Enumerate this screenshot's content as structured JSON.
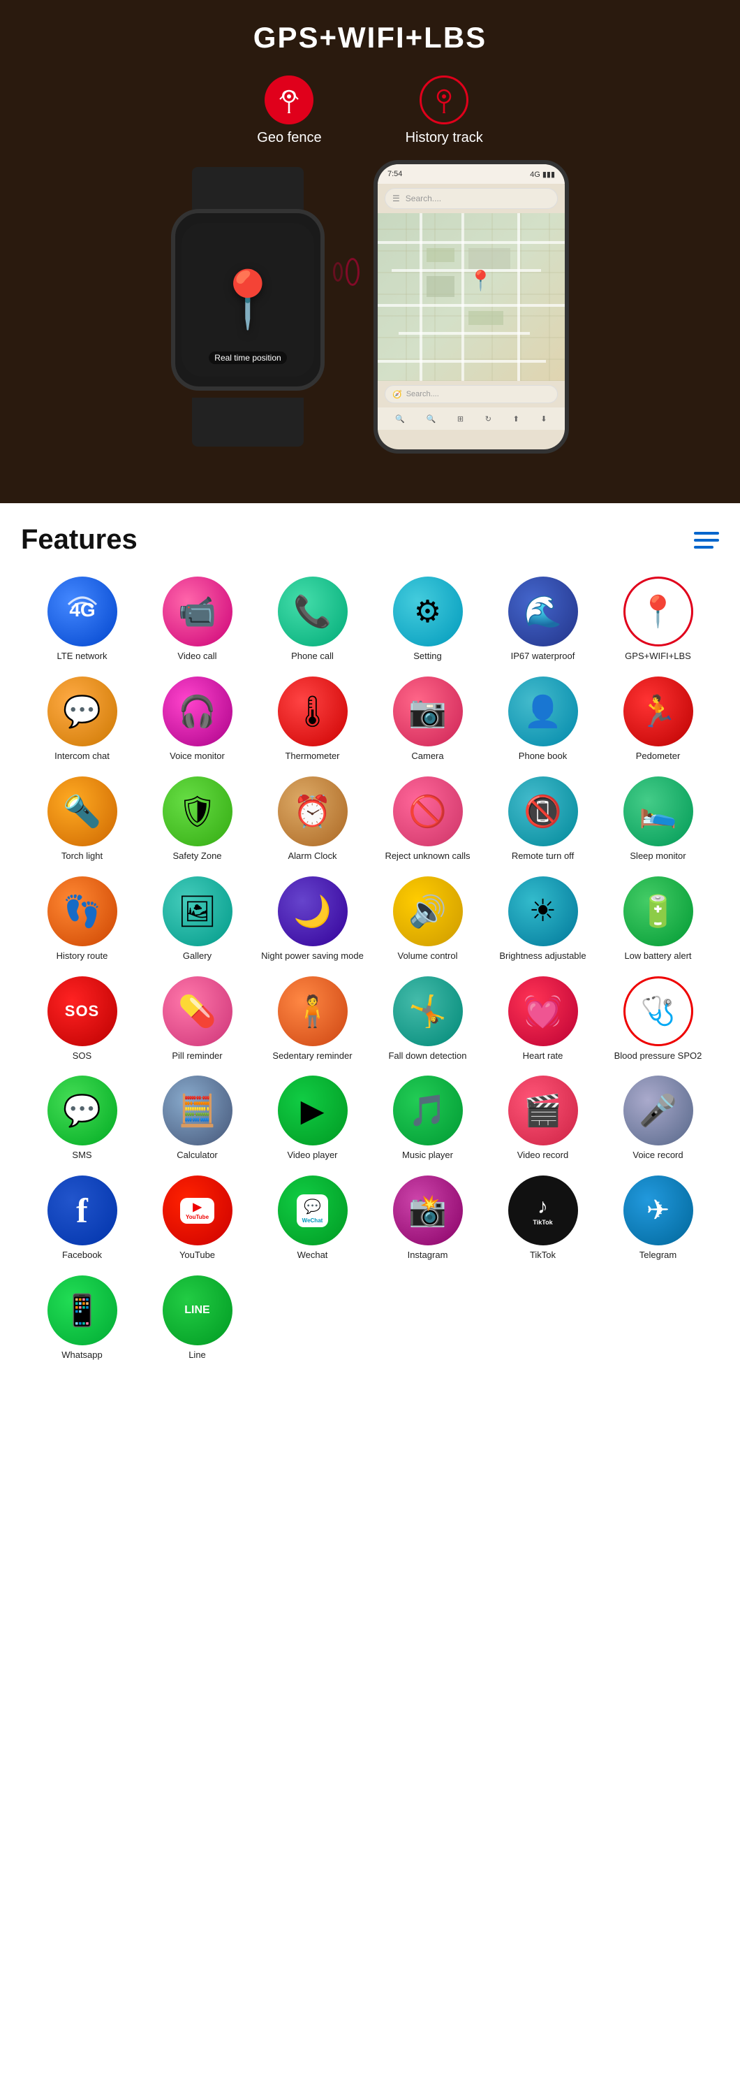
{
  "hero": {
    "title": "GPS+WIFI+LBS",
    "geo_fence_label": "Geo fence",
    "history_track_label": "History track",
    "watch_label": "Real time position"
  },
  "features": {
    "title": "Features",
    "items": [
      {
        "id": "lte",
        "label": "LTE network",
        "icon": "4G",
        "bg": "bg-blue-grad",
        "emoji": ""
      },
      {
        "id": "video-call",
        "label": "Video call",
        "icon": "📹",
        "bg": "bg-pink-grad"
      },
      {
        "id": "phone-call",
        "label": "Phone call",
        "icon": "📞",
        "bg": "bg-green-grad"
      },
      {
        "id": "setting",
        "label": "Setting",
        "icon": "⚙️",
        "bg": "bg-teal-grad"
      },
      {
        "id": "waterproof",
        "label": "IP67 waterproof",
        "icon": "🌊",
        "bg": "bg-navy-grad"
      },
      {
        "id": "gps",
        "label": "GPS+WIFI+LBS",
        "icon": "📍",
        "bg": "bg-red-outline"
      },
      {
        "id": "intercom-chat",
        "label": "Intercom chat",
        "icon": "💬",
        "bg": "bg-orange-chat"
      },
      {
        "id": "voice-monitor",
        "label": "Voice monitor",
        "icon": "🎧",
        "bg": "bg-magenta"
      },
      {
        "id": "thermometer",
        "label": "Thermometer",
        "icon": "🌡️",
        "bg": "bg-red-thermo"
      },
      {
        "id": "camera",
        "label": "Camera",
        "icon": "📷",
        "bg": "bg-pink-cam"
      },
      {
        "id": "phone-book",
        "label": "Phone book",
        "icon": "👤",
        "bg": "bg-teal-book"
      },
      {
        "id": "pedometer",
        "label": "Pedometer",
        "icon": "🏃",
        "bg": "bg-red-run"
      },
      {
        "id": "torch",
        "label": "Torch light",
        "icon": "🔦",
        "bg": "bg-orange-torch"
      },
      {
        "id": "safety-zone",
        "label": "Safety Zone",
        "icon": "🛡️",
        "bg": "bg-green-safe"
      },
      {
        "id": "alarm-clock",
        "label": "Alarm Clock",
        "icon": "⏰",
        "bg": "bg-brown-alarm"
      },
      {
        "id": "reject-calls",
        "label": "Reject unknown calls",
        "icon": "🚫",
        "bg": "bg-pink-reject"
      },
      {
        "id": "remote-turnoff",
        "label": "Remote turn off",
        "icon": "📱",
        "bg": "bg-teal-remote"
      },
      {
        "id": "sleep-monitor",
        "label": "Sleep monitor",
        "icon": "🛌",
        "bg": "bg-green-sleep"
      },
      {
        "id": "history-route",
        "label": "History route",
        "icon": "👣",
        "bg": "bg-orange-foot"
      },
      {
        "id": "gallery",
        "label": "Gallery",
        "icon": "🖼️",
        "bg": "bg-teal-gallery"
      },
      {
        "id": "night-power",
        "label": "Night power saving mode",
        "icon": "🌙",
        "bg": "bg-purple-night"
      },
      {
        "id": "volume-control",
        "label": "Volume control",
        "icon": "🔊",
        "bg": "bg-yellow-vol"
      },
      {
        "id": "brightness",
        "label": "Brightness adjustable",
        "icon": "☀️",
        "bg": "bg-teal-bright"
      },
      {
        "id": "low-battery",
        "label": "Low battery alert",
        "icon": "🔋",
        "bg": "bg-green-battery"
      },
      {
        "id": "sos",
        "label": "SOS",
        "icon": "SOS",
        "bg": "bg-red-sos"
      },
      {
        "id": "pill",
        "label": "Pill reminder",
        "icon": "💊",
        "bg": "bg-pink-pill"
      },
      {
        "id": "sedentary",
        "label": "Sedentary reminder",
        "icon": "🧍",
        "bg": "bg-orange-sed"
      },
      {
        "id": "fall-detection",
        "label": "Fall down detection",
        "icon": "🤸",
        "bg": "bg-teal-fall"
      },
      {
        "id": "heart-rate",
        "label": "Heart rate",
        "icon": "💓",
        "bg": "bg-red-heart"
      },
      {
        "id": "blood-pressure",
        "label": "Blood pressure SPO2",
        "icon": "🩺",
        "bg": "bg-red-bp"
      },
      {
        "id": "sms",
        "label": "SMS",
        "icon": "💬",
        "bg": "bg-green-sms"
      },
      {
        "id": "calculator",
        "label": "Calculator",
        "icon": "🧮",
        "bg": "bg-gray-calc"
      },
      {
        "id": "video-player",
        "label": "Video player",
        "icon": "▶️",
        "bg": "bg-green-vid"
      },
      {
        "id": "music-player",
        "label": "Music player",
        "icon": "🎵",
        "bg": "bg-green-music"
      },
      {
        "id": "video-record",
        "label": "Video record",
        "icon": "🎬",
        "bg": "bg-pink-vrec"
      },
      {
        "id": "voice-record",
        "label": "Voice record",
        "icon": "🎤",
        "bg": "bg-gray-voice"
      },
      {
        "id": "facebook",
        "label": "Facebook",
        "icon": "f",
        "bg": "bg-blue-fb"
      },
      {
        "id": "youtube",
        "label": "YouTube",
        "icon": "▶",
        "bg": "bg-red-yt"
      },
      {
        "id": "wechat",
        "label": "Wechat",
        "icon": "WeChat",
        "bg": "bg-green-wechat"
      },
      {
        "id": "instagram",
        "label": "Instagram",
        "icon": "📸",
        "bg": "bg-purple-insta"
      },
      {
        "id": "tiktok",
        "label": "TikTok",
        "icon": "♪",
        "bg": "bg-dark-tiktok"
      },
      {
        "id": "telegram",
        "label": "Telegram",
        "icon": "✈",
        "bg": "bg-blue-telegram"
      },
      {
        "id": "whatsapp",
        "label": "Whatsapp",
        "icon": "📱",
        "bg": "bg-green-whatsapp"
      },
      {
        "id": "line",
        "label": "Line",
        "icon": "LINE",
        "bg": "bg-green-line"
      }
    ]
  }
}
